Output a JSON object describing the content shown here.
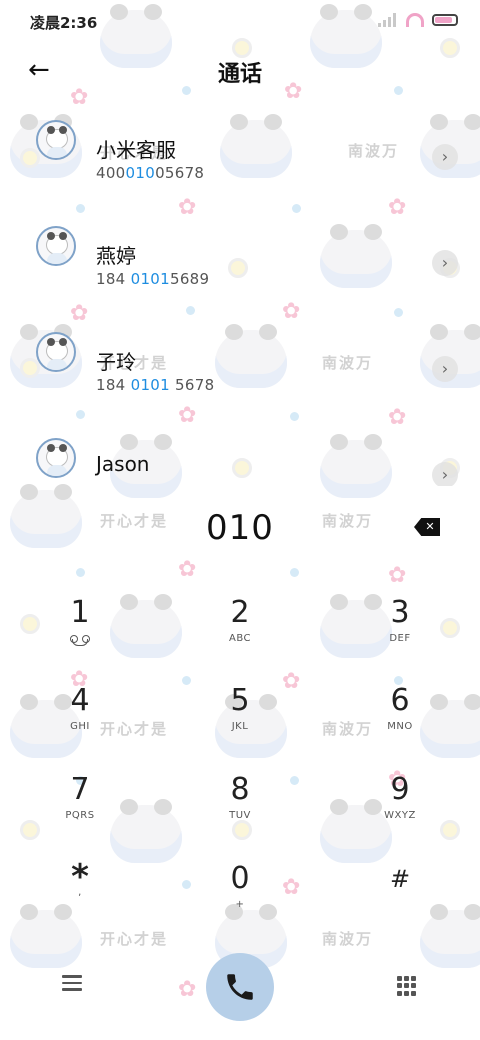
{
  "status_bar": {
    "time": "凌晨2:36",
    "icons": [
      "signal-icon",
      "wifi-icon",
      "battery-icon"
    ],
    "battery_level": 0.85
  },
  "header": {
    "title": "通话",
    "back_icon": "←"
  },
  "contacts": [
    {
      "name": "小米客服",
      "number_prefix": "400",
      "number_match": "010",
      "number_suffix": "05678"
    },
    {
      "name": "燕婷",
      "number_prefix": "184 ",
      "number_match": "0101",
      "number_suffix": "5689"
    },
    {
      "name": "子玲",
      "number_prefix": "184 ",
      "number_match": "0101",
      "number_suffix": " 5678"
    },
    {
      "name": "Jason",
      "number_prefix": "",
      "number_match": "",
      "number_suffix": ""
    }
  ],
  "dial": {
    "number": "010"
  },
  "keypad": {
    "keys": [
      {
        "digit": "1",
        "letters": ""
      },
      {
        "digit": "2",
        "letters": "ABC"
      },
      {
        "digit": "3",
        "letters": "DEF"
      },
      {
        "digit": "4",
        "letters": "GHI"
      },
      {
        "digit": "5",
        "letters": "JKL"
      },
      {
        "digit": "6",
        "letters": "MNO"
      },
      {
        "digit": "7",
        "letters": "PQRS"
      },
      {
        "digit": "8",
        "letters": "TUV"
      },
      {
        "digit": "9",
        "letters": "WXYZ"
      },
      {
        "digit": "*",
        "letters": ","
      },
      {
        "digit": "0",
        "letters": "+"
      },
      {
        "digit": "#",
        "letters": ""
      }
    ]
  },
  "wallpaper": {
    "texts": [
      "开心才是",
      "南波万"
    ]
  },
  "colors": {
    "highlight": "#1e8de0",
    "call_button": "#b6cfe8",
    "accent_pink": "#f0a3c7"
  }
}
